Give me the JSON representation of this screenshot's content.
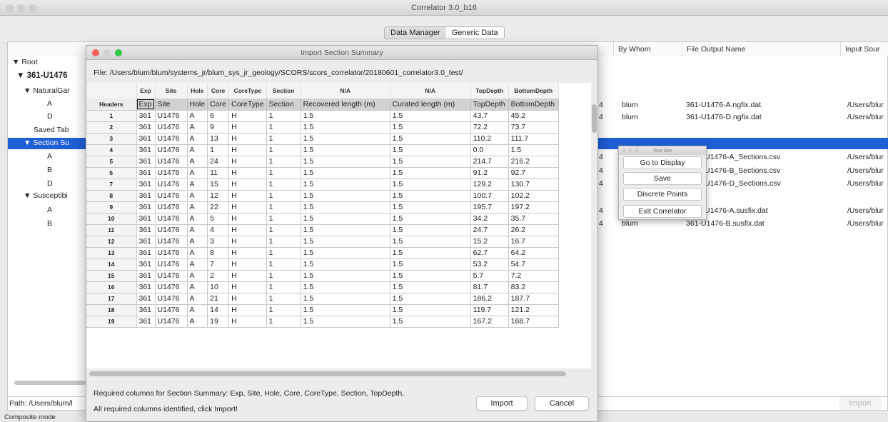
{
  "window": {
    "title": "Correlator 3.0_b16"
  },
  "tabs": [
    {
      "label": "Data Manager"
    },
    {
      "label": "Generic Data"
    }
  ],
  "columns": {
    "by_whom": "By Whom",
    "file_output": "File Output Name",
    "input_source": "Input Sour"
  },
  "tree": {
    "root": "Root",
    "site": "361-U1476",
    "natural": "NaturalGar",
    "holes_ng": [
      "A",
      "D"
    ],
    "saved": "Saved Tab",
    "section": "Section Su",
    "holes_sec": [
      "A",
      "B",
      "D"
    ],
    "susc": "Susceptibi",
    "holes_susc": [
      "A",
      "B"
    ]
  },
  "right_rows": [
    {
      "mark": "4",
      "by": "blum",
      "file": "361-U1476-A.ngfix.dat",
      "src": "/Users/blur"
    },
    {
      "mark": "4",
      "by": "blum",
      "file": "361-U1476-D.ngfix.dat",
      "src": "/Users/blur"
    },
    {
      "mark": "4",
      "by": "",
      "file": "U1476-A_Sections.csv",
      "src": "/Users/blur"
    },
    {
      "mark": "4",
      "by": "",
      "file": "U1476-B_Sections.csv",
      "src": "/Users/blur"
    },
    {
      "mark": "4",
      "by": "",
      "file": "U1476-D_Sections.csv",
      "src": "/Users/blur"
    },
    {
      "mark": "4",
      "by": "",
      "file": "U1476-A.susfix.dat",
      "src": "/Users/blur"
    },
    {
      "mark": "4",
      "by": "blum",
      "file": "361-U1476-B.susfix.dat",
      "src": "/Users/blur"
    }
  ],
  "path_bar": {
    "text": "Path: /Users/blum/l"
  },
  "import_main": "Import",
  "status_bar": "Composite mode",
  "dialog": {
    "title": "Import Section Summary",
    "file_path": "File: /Users/blum/blum/systems_jr/blum_sys_jr_geology/SCORS/scors_correlator/20180601_correlator3.0_test/",
    "column_heads": [
      "",
      "Exp",
      "Site",
      "Hole",
      "Core",
      "CoreType",
      "Section",
      "N/A",
      "N/A",
      "TopDepth",
      "BottomDepth"
    ],
    "header_row": [
      "Headers",
      "Exp",
      "Site",
      "Hole",
      "Core",
      "CoreType",
      "Section",
      "Recovered length (m)",
      "Curated length (m)",
      "TopDepth",
      "BottomDepth"
    ],
    "rows": [
      [
        "1",
        "361",
        "U1476",
        "A",
        "6",
        "H",
        "1",
        "1.5",
        "1.5",
        "43.7",
        "45.2"
      ],
      [
        "2",
        "361",
        "U1476",
        "A",
        "9",
        "H",
        "1",
        "1.5",
        "1.5",
        "72.2",
        "73.7"
      ],
      [
        "3",
        "361",
        "U1476",
        "A",
        "13",
        "H",
        "1",
        "1.5",
        "1.5",
        "110.2",
        "111.7"
      ],
      [
        "4",
        "361",
        "U1476",
        "A",
        "1",
        "H",
        "1",
        "1.5",
        "1.5",
        "0.0",
        "1.5"
      ],
      [
        "5",
        "361",
        "U1476",
        "A",
        "24",
        "H",
        "1",
        "1.5",
        "1.5",
        "214.7",
        "216.2"
      ],
      [
        "6",
        "361",
        "U1476",
        "A",
        "11",
        "H",
        "1",
        "1.5",
        "1.5",
        "91.2",
        "92.7"
      ],
      [
        "7",
        "361",
        "U1476",
        "A",
        "15",
        "H",
        "1",
        "1.5",
        "1.5",
        "129.2",
        "130.7"
      ],
      [
        "8",
        "361",
        "U1476",
        "A",
        "12",
        "H",
        "1",
        "1.5",
        "1.5",
        "100.7",
        "102.2"
      ],
      [
        "9",
        "361",
        "U1476",
        "A",
        "22",
        "H",
        "1",
        "1.5",
        "1.5",
        "195.7",
        "197.2"
      ],
      [
        "10",
        "361",
        "U1476",
        "A",
        "5",
        "H",
        "1",
        "1.5",
        "1.5",
        "34.2",
        "35.7"
      ],
      [
        "11",
        "361",
        "U1476",
        "A",
        "4",
        "H",
        "1",
        "1.5",
        "1.5",
        "24.7",
        "26.2"
      ],
      [
        "12",
        "361",
        "U1476",
        "A",
        "3",
        "H",
        "1",
        "1.5",
        "1.5",
        "15.2",
        "16.7"
      ],
      [
        "13",
        "361",
        "U1476",
        "A",
        "8",
        "H",
        "1",
        "1.5",
        "1.5",
        "62.7",
        "64.2"
      ],
      [
        "14",
        "361",
        "U1476",
        "A",
        "7",
        "H",
        "1",
        "1.5",
        "1.5",
        "53.2",
        "54.7"
      ],
      [
        "15",
        "361",
        "U1476",
        "A",
        "2",
        "H",
        "1",
        "1.5",
        "1.5",
        "5.7",
        "7.2"
      ],
      [
        "16",
        "361",
        "U1476",
        "A",
        "10",
        "H",
        "1",
        "1.5",
        "1.5",
        "81.7",
        "83.2"
      ],
      [
        "17",
        "361",
        "U1476",
        "A",
        "21",
        "H",
        "1",
        "1.5",
        "1.5",
        "186.2",
        "187.7"
      ],
      [
        "18",
        "361",
        "U1476",
        "A",
        "14",
        "H",
        "1",
        "1.5",
        "1.5",
        "119.7",
        "121.2"
      ],
      [
        "19",
        "361",
        "U1476",
        "A",
        "19",
        "H",
        "1",
        "1.5",
        "1.5",
        "167.2",
        "168.7"
      ]
    ],
    "required_text": "Required columns for Section Summary: Exp, Site, Hole, Core, CoreType, Section, TopDepth,",
    "status_text": "All required columns identified, click Import!",
    "import_label": "Import",
    "cancel_label": "Cancel"
  },
  "toolbar": {
    "title": "Tool Bar",
    "buttons": [
      "Go to Display",
      "Save",
      "Discrete Points",
      "Exit Correlator"
    ]
  },
  "colors": {
    "selection": "#1f5fd6",
    "close": "#fc5f57",
    "minimize": "#fdbc2e",
    "zoom": "#33c748"
  }
}
